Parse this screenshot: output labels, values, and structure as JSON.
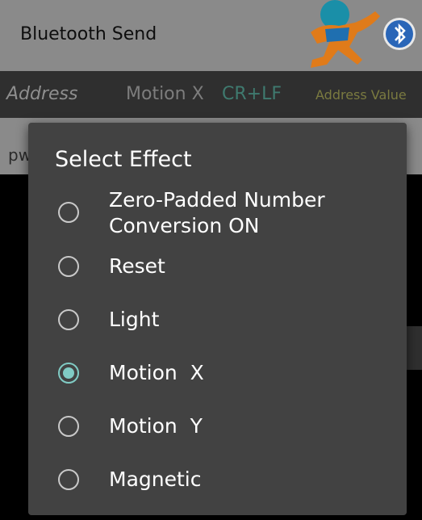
{
  "app": {
    "title": "Bluetooth Send"
  },
  "toolbar": {
    "address_label": "Address",
    "motion_label": "Motion X",
    "crlf_label": "CR+LF",
    "address_value_label": "Address Value"
  },
  "input": {
    "partial_text": "pw"
  },
  "dialog": {
    "title": "Select Effect",
    "options": [
      {
        "label_line1": "Zero-Padded Number",
        "label_line2": "Conversion ON",
        "selected": false
      },
      {
        "label": "Reset",
        "selected": false
      },
      {
        "label": "Light",
        "selected": false
      },
      {
        "label": "Motion  X",
        "selected": true
      },
      {
        "label": "Motion  Y",
        "selected": false
      },
      {
        "label": "Magnetic",
        "selected": false
      }
    ]
  },
  "colors": {
    "accent": "#80cbc4",
    "dialog_bg": "#424242"
  }
}
